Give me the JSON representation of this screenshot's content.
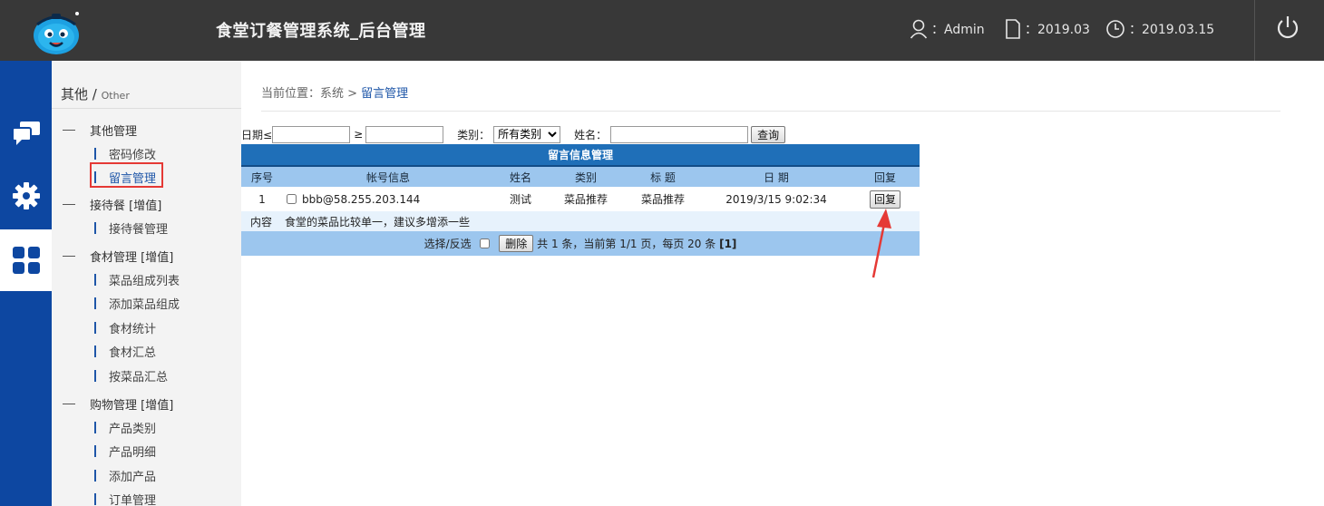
{
  "header": {
    "title": "食堂订餐管理系统_后台管理",
    "user_label": "：Admin",
    "month_label": "：2019.03",
    "date_label": "：2019.03.15"
  },
  "rail": {
    "items": [
      {
        "icon": "chat-icon"
      },
      {
        "icon": "gear-icon"
      },
      {
        "icon": "grid-icon",
        "active": true
      }
    ]
  },
  "sidebar": {
    "heading": "其他",
    "heading_sub": "Other",
    "groups": [
      {
        "label": "其他管理",
        "items": [
          "密码修改",
          "留言管理"
        ]
      },
      {
        "label": "接待餐 [增值]",
        "items": [
          "接待餐管理"
        ]
      },
      {
        "label": "食材管理 [增值]",
        "items": [
          "菜品组成列表",
          "添加菜品组成",
          "食材统计",
          "食材汇总",
          "按菜品汇总"
        ]
      },
      {
        "label": "购物管理 [增值]",
        "items": [
          "产品类别",
          "产品明细",
          "添加产品",
          "订单管理"
        ]
      }
    ]
  },
  "breadcrumb": {
    "prefix": "当前位置：系统 > ",
    "current": "留言管理"
  },
  "filter": {
    "date_le_label": "日期≤",
    "date_ge_label": "≥",
    "date_le_value": "",
    "date_ge_value": "",
    "category_label": "类别：",
    "category_selected": "所有类别",
    "name_label": "姓名：",
    "name_value": "",
    "search_button": "查询"
  },
  "table": {
    "caption": "留言信息管理",
    "columns": [
      "序号",
      "帐号信息",
      "姓名",
      "类别",
      "标 题",
      "日 期",
      "回复"
    ],
    "rows": [
      {
        "index": "1",
        "account": "bbb@58.255.203.144",
        "name": "测试",
        "category": "菜品推荐",
        "title": "菜品推荐",
        "date": "2019/3/15 9:02:34",
        "reply_button": "回复",
        "content_label": "内容",
        "content": "食堂的菜品比较单一，建议多增添一些"
      }
    ],
    "footer": {
      "select_label": "选择/反选",
      "delete_button": "删除",
      "summary": "共 1 条，当前第 1/1 页，每页 20 条",
      "page_link": "[1]"
    }
  },
  "colors": {
    "header_bg": "#383838",
    "rail_bg": "#0d47a1",
    "table_caption_bg": "#1f6fb8",
    "table_header_bg": "#9cc6ee",
    "highlight_red": "#e53935"
  }
}
